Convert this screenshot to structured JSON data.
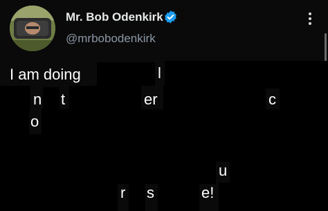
{
  "tweet": {
    "author": {
      "display_name": "Mr. Bob Odenkirk",
      "handle": "@mrbobodenkirk",
      "verified_icon": "verified-badge-icon",
      "avatar_icon": "avatar-photo"
    },
    "menu_icon": "more-vertical-icon",
    "visible_text": {
      "line1_start": "I am doing",
      "line1_frag": "l",
      "line2_frag1": "n",
      "line2_frag2": "t",
      "line2_frag3": "er",
      "line2_frag4": "c",
      "line3_frag1": "o",
      "line5_frag1": "u",
      "line6_frag1": "r",
      "line6_frag2": "s",
      "line6_frag3": "e!"
    }
  },
  "colors": {
    "background": "#0a0a0a",
    "redaction": "#000000",
    "text": "#ffffff",
    "name": "#e7e9ea",
    "handle": "#8b98a5",
    "verified": "#1d9bf0"
  }
}
